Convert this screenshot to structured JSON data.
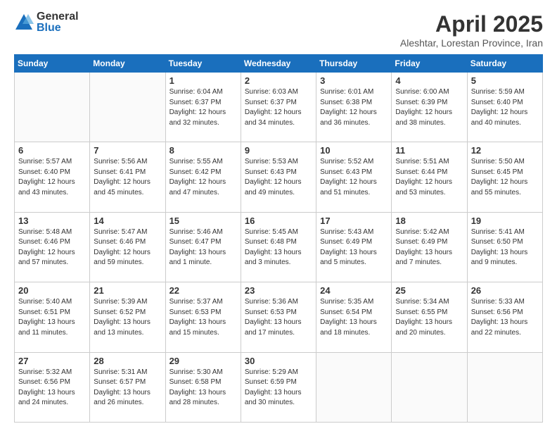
{
  "logo": {
    "general": "General",
    "blue": "Blue"
  },
  "title": "April 2025",
  "subtitle": "Aleshtar, Lorestan Province, Iran",
  "days_header": [
    "Sunday",
    "Monday",
    "Tuesday",
    "Wednesday",
    "Thursday",
    "Friday",
    "Saturday"
  ],
  "weeks": [
    [
      {
        "day": "",
        "info": ""
      },
      {
        "day": "",
        "info": ""
      },
      {
        "day": "1",
        "info": "Sunrise: 6:04 AM\nSunset: 6:37 PM\nDaylight: 12 hours\nand 32 minutes."
      },
      {
        "day": "2",
        "info": "Sunrise: 6:03 AM\nSunset: 6:37 PM\nDaylight: 12 hours\nand 34 minutes."
      },
      {
        "day": "3",
        "info": "Sunrise: 6:01 AM\nSunset: 6:38 PM\nDaylight: 12 hours\nand 36 minutes."
      },
      {
        "day": "4",
        "info": "Sunrise: 6:00 AM\nSunset: 6:39 PM\nDaylight: 12 hours\nand 38 minutes."
      },
      {
        "day": "5",
        "info": "Sunrise: 5:59 AM\nSunset: 6:40 PM\nDaylight: 12 hours\nand 40 minutes."
      }
    ],
    [
      {
        "day": "6",
        "info": "Sunrise: 5:57 AM\nSunset: 6:40 PM\nDaylight: 12 hours\nand 43 minutes."
      },
      {
        "day": "7",
        "info": "Sunrise: 5:56 AM\nSunset: 6:41 PM\nDaylight: 12 hours\nand 45 minutes."
      },
      {
        "day": "8",
        "info": "Sunrise: 5:55 AM\nSunset: 6:42 PM\nDaylight: 12 hours\nand 47 minutes."
      },
      {
        "day": "9",
        "info": "Sunrise: 5:53 AM\nSunset: 6:43 PM\nDaylight: 12 hours\nand 49 minutes."
      },
      {
        "day": "10",
        "info": "Sunrise: 5:52 AM\nSunset: 6:43 PM\nDaylight: 12 hours\nand 51 minutes."
      },
      {
        "day": "11",
        "info": "Sunrise: 5:51 AM\nSunset: 6:44 PM\nDaylight: 12 hours\nand 53 minutes."
      },
      {
        "day": "12",
        "info": "Sunrise: 5:50 AM\nSunset: 6:45 PM\nDaylight: 12 hours\nand 55 minutes."
      }
    ],
    [
      {
        "day": "13",
        "info": "Sunrise: 5:48 AM\nSunset: 6:46 PM\nDaylight: 12 hours\nand 57 minutes."
      },
      {
        "day": "14",
        "info": "Sunrise: 5:47 AM\nSunset: 6:46 PM\nDaylight: 12 hours\nand 59 minutes."
      },
      {
        "day": "15",
        "info": "Sunrise: 5:46 AM\nSunset: 6:47 PM\nDaylight: 13 hours\nand 1 minute."
      },
      {
        "day": "16",
        "info": "Sunrise: 5:45 AM\nSunset: 6:48 PM\nDaylight: 13 hours\nand 3 minutes."
      },
      {
        "day": "17",
        "info": "Sunrise: 5:43 AM\nSunset: 6:49 PM\nDaylight: 13 hours\nand 5 minutes."
      },
      {
        "day": "18",
        "info": "Sunrise: 5:42 AM\nSunset: 6:49 PM\nDaylight: 13 hours\nand 7 minutes."
      },
      {
        "day": "19",
        "info": "Sunrise: 5:41 AM\nSunset: 6:50 PM\nDaylight: 13 hours\nand 9 minutes."
      }
    ],
    [
      {
        "day": "20",
        "info": "Sunrise: 5:40 AM\nSunset: 6:51 PM\nDaylight: 13 hours\nand 11 minutes."
      },
      {
        "day": "21",
        "info": "Sunrise: 5:39 AM\nSunset: 6:52 PM\nDaylight: 13 hours\nand 13 minutes."
      },
      {
        "day": "22",
        "info": "Sunrise: 5:37 AM\nSunset: 6:53 PM\nDaylight: 13 hours\nand 15 minutes."
      },
      {
        "day": "23",
        "info": "Sunrise: 5:36 AM\nSunset: 6:53 PM\nDaylight: 13 hours\nand 17 minutes."
      },
      {
        "day": "24",
        "info": "Sunrise: 5:35 AM\nSunset: 6:54 PM\nDaylight: 13 hours\nand 18 minutes."
      },
      {
        "day": "25",
        "info": "Sunrise: 5:34 AM\nSunset: 6:55 PM\nDaylight: 13 hours\nand 20 minutes."
      },
      {
        "day": "26",
        "info": "Sunrise: 5:33 AM\nSunset: 6:56 PM\nDaylight: 13 hours\nand 22 minutes."
      }
    ],
    [
      {
        "day": "27",
        "info": "Sunrise: 5:32 AM\nSunset: 6:56 PM\nDaylight: 13 hours\nand 24 minutes."
      },
      {
        "day": "28",
        "info": "Sunrise: 5:31 AM\nSunset: 6:57 PM\nDaylight: 13 hours\nand 26 minutes."
      },
      {
        "day": "29",
        "info": "Sunrise: 5:30 AM\nSunset: 6:58 PM\nDaylight: 13 hours\nand 28 minutes."
      },
      {
        "day": "30",
        "info": "Sunrise: 5:29 AM\nSunset: 6:59 PM\nDaylight: 13 hours\nand 30 minutes."
      },
      {
        "day": "",
        "info": ""
      },
      {
        "day": "",
        "info": ""
      },
      {
        "day": "",
        "info": ""
      }
    ]
  ]
}
